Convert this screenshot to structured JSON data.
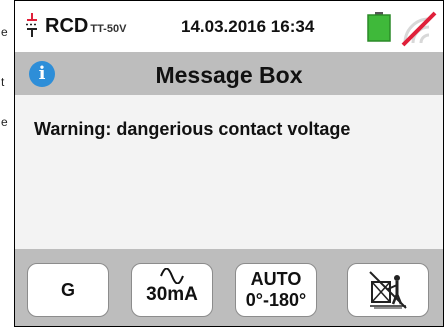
{
  "left_fragment": [
    "e",
    "t",
    "e"
  ],
  "status_bar": {
    "mode": "RCD",
    "mode_subscript": "TT-50V",
    "datetime": "14.03.2016 16:34",
    "icons": [
      "rcd-symbol-icon",
      "battery-icon",
      "signal-off-icon"
    ],
    "battery_color": "#3fb93a",
    "signal_slash_color": "#e0203a"
  },
  "message_box": {
    "title": "Message Box",
    "icon": "info-icon",
    "info_glyph": "i",
    "message": "Warning: dangerious contact voltage"
  },
  "softkeys": {
    "g_label": "G",
    "current": {
      "icon": "sine-wave-icon",
      "label": "30mA"
    },
    "phase": {
      "line1": "AUTO",
      "line2": "0°-180°"
    },
    "touch_icon": "no-touch-voltage-icon"
  }
}
